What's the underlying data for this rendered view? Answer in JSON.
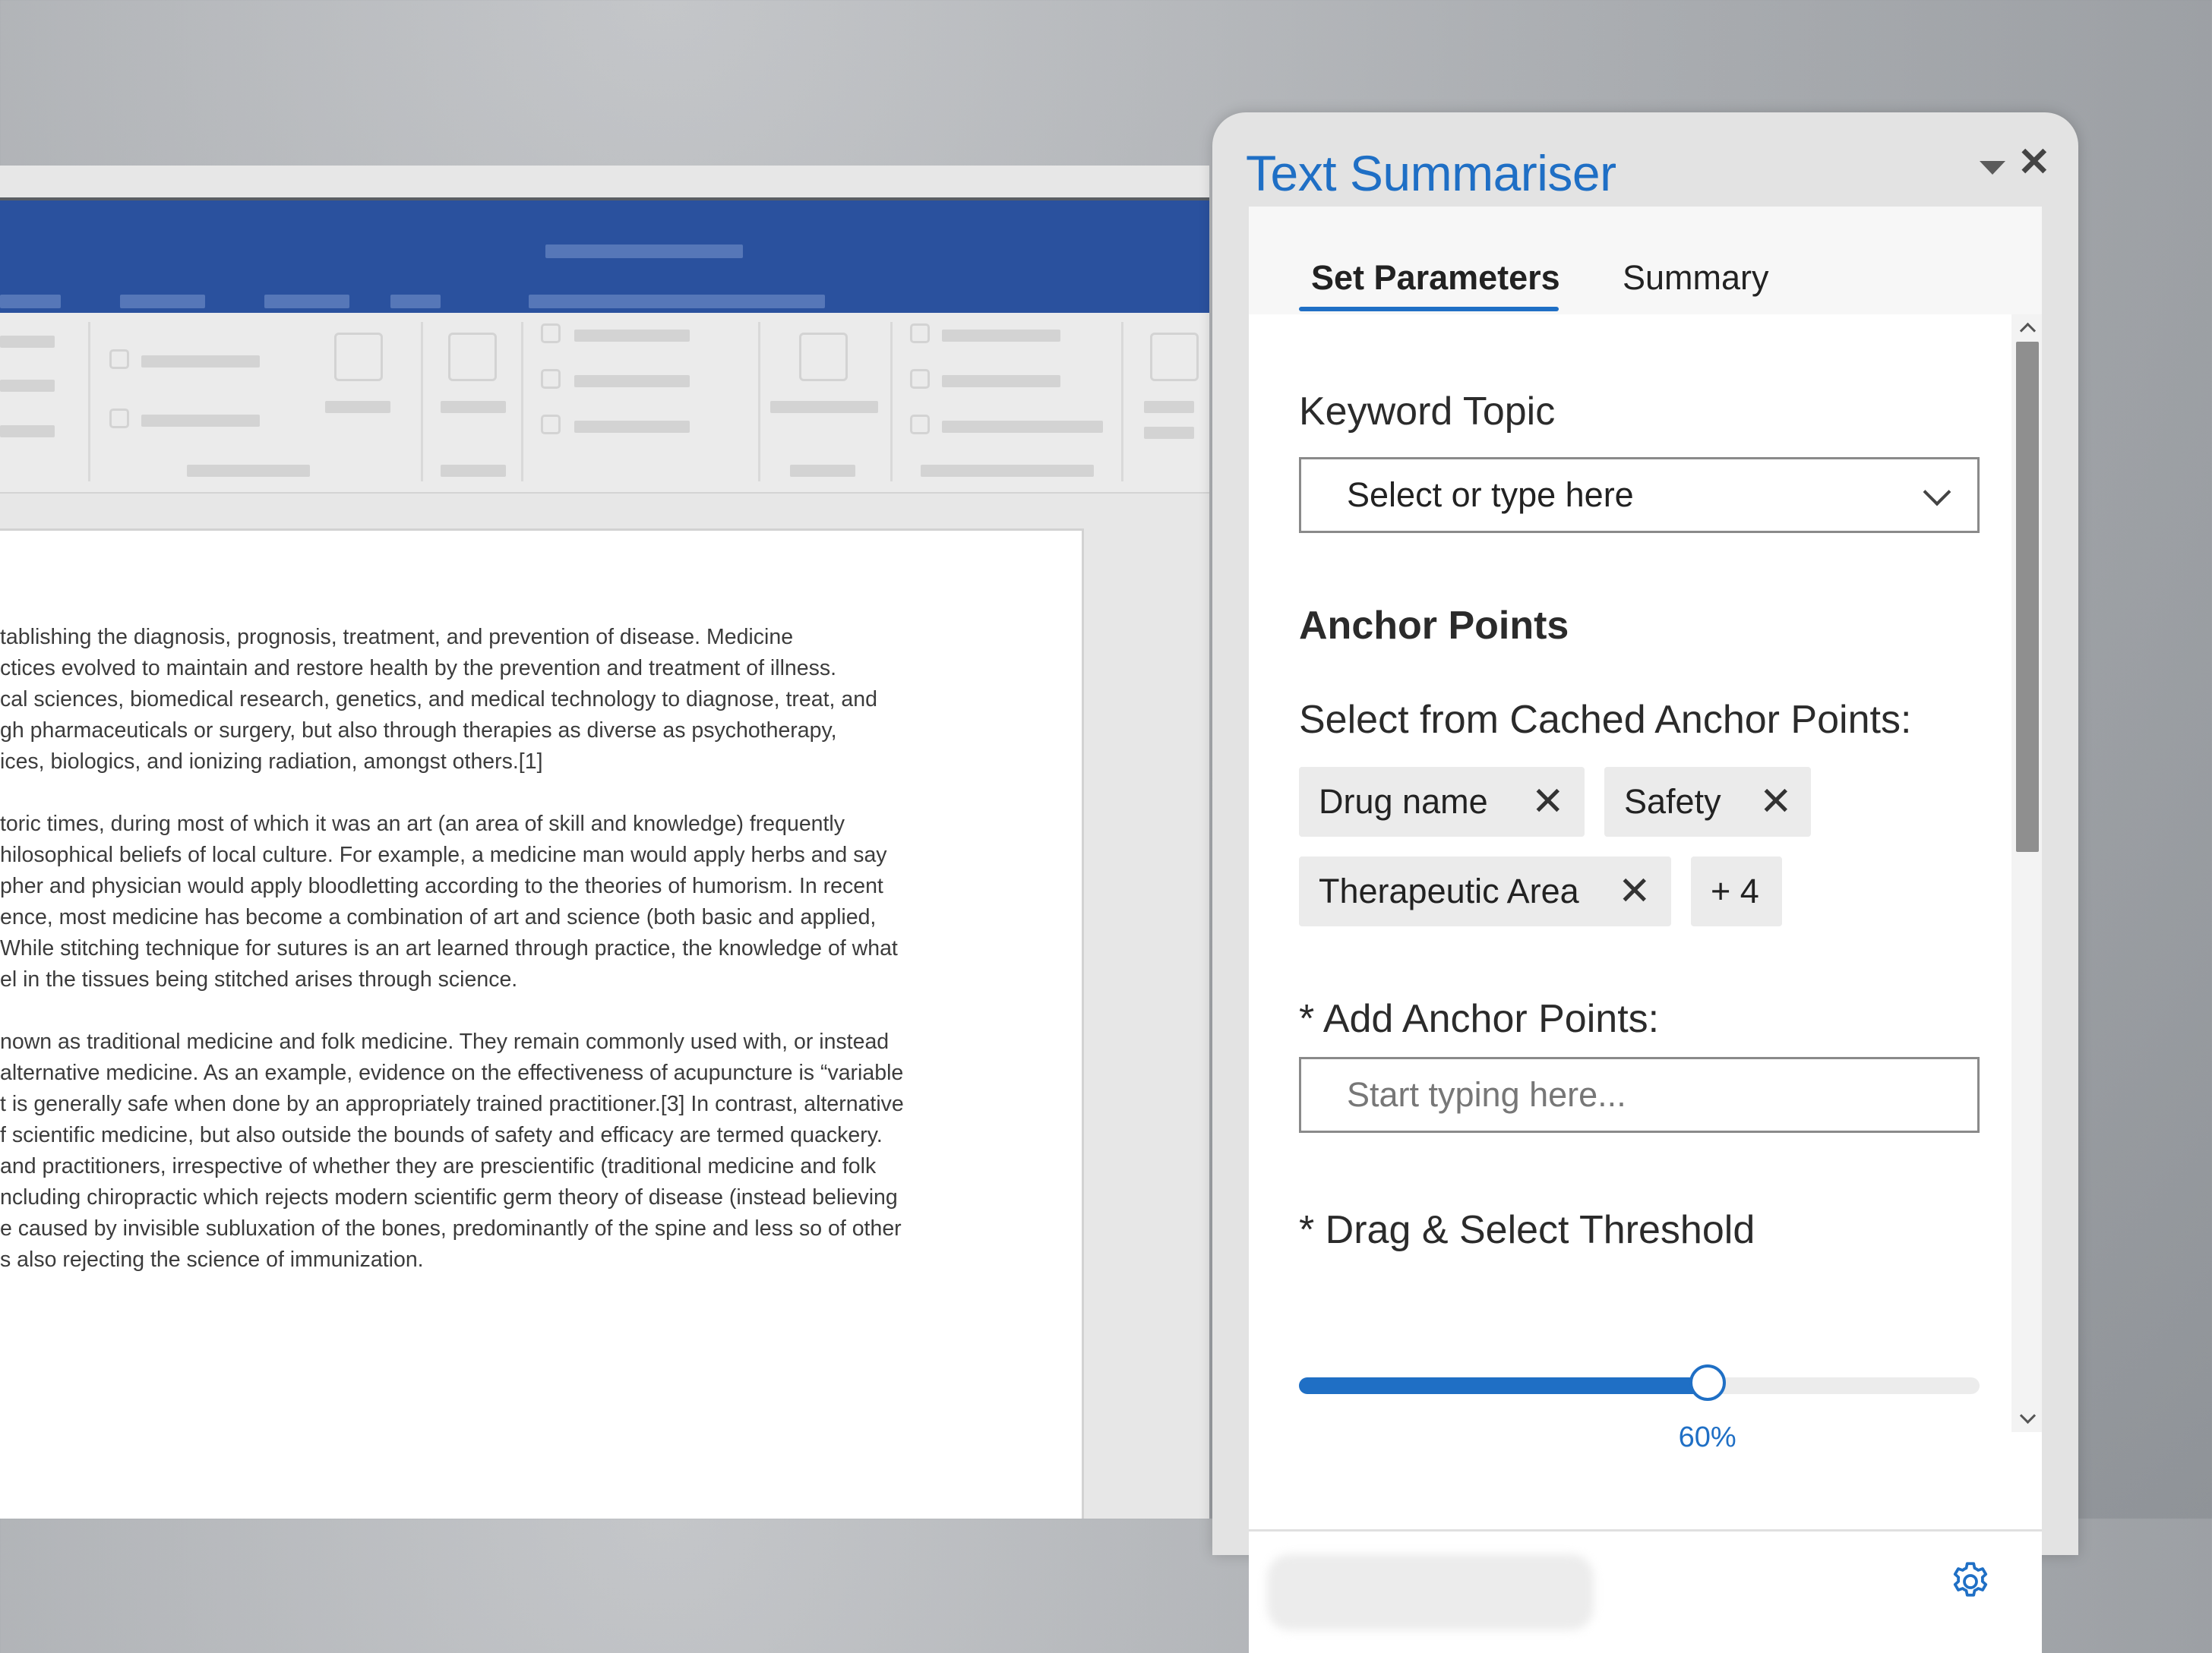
{
  "document": {
    "paragraphs": [
      [
        "tablishing the diagnosis, prognosis, treatment, and prevention of disease. Medicine",
        "ctices evolved to maintain and restore health by the prevention and treatment of illness.",
        "cal sciences, biomedical research, genetics, and medical technology to diagnose, treat, and",
        "gh pharmaceuticals or surgery, but also through therapies as diverse as psychotherapy,",
        "ices, biologics, and ionizing radiation, amongst others.[1]"
      ],
      [
        "toric times, during most of which it was an art (an area of skill and knowledge) frequently",
        "hilosophical beliefs of local culture. For example, a medicine man would apply herbs and say",
        "pher and physician would apply bloodletting according to the theories of humorism. In recent",
        "ence, most medicine has become a combination of art and science (both basic and applied,",
        "While stitching technique for sutures is an art learned through practice, the knowledge of what",
        "el in the tissues being stitched arises through science."
      ],
      [
        "nown as traditional medicine and folk medicine. They remain commonly used with, or instead",
        "alternative medicine. As an example, evidence on the effectiveness of acupuncture is “variable",
        "t is generally safe when done by an appropriately trained practitioner.[3] In contrast, alternative",
        "f scientific medicine, but also outside the bounds of safety and efficacy are termed quackery.",
        "and practitioners, irrespective of whether they are prescientific (traditional medicine and folk",
        "ncluding chiropractic which rejects modern scientific germ theory of disease (instead believing",
        "e caused by invisible subluxation of the bones, predominantly of the spine and less so of other",
        "s also rejecting the science of immunization."
      ]
    ]
  },
  "panel": {
    "title": "Text Summariser",
    "tabs": [
      {
        "label": "Set Parameters",
        "active": true
      },
      {
        "label": "Summary",
        "active": false
      }
    ],
    "keyword_topic": {
      "label": "Keyword Topic",
      "placeholder": "Select or type here"
    },
    "anchor_points": {
      "heading": "Anchor Points",
      "cached_label": "Select from Cached Anchor Points:",
      "chips": [
        "Drug name",
        "Safety",
        "Therapeutic Area"
      ],
      "more": "+ 4",
      "add_label": "* Add Anchor Points:",
      "add_placeholder": "Start typing here..."
    },
    "threshold": {
      "label": "* Drag & Select Threshold",
      "value_percent": 60,
      "value_text": "60%"
    },
    "accent_color": "#1f6fc5"
  }
}
